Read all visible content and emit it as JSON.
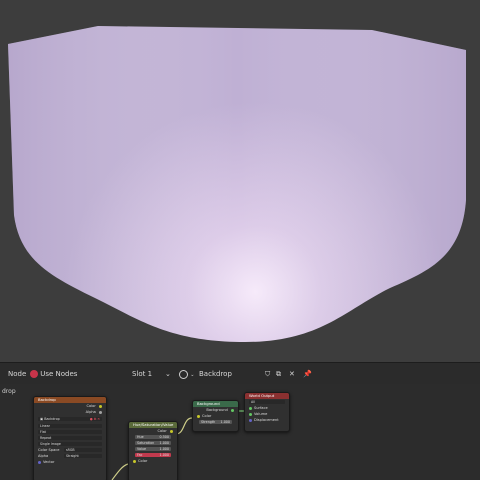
{
  "header": {
    "editor_type": "Node",
    "use_nodes_label": "Use Nodes",
    "slot_label": "Slot 1",
    "world_name": "Backdrop",
    "sidebar_fragment": "drop"
  },
  "colors": {
    "backdrop_shape": "#c7b8da",
    "viewport_bg": "#3d3d3d",
    "editor_bg": "#2c2c2c",
    "texture_header": "#8a4a24",
    "converter_header": "#5a6a3a",
    "shader_header": "#3a6a4a",
    "output_header": "#8a3030",
    "wire": "#cfcf8a"
  },
  "nodes": {
    "image_texture": {
      "title": "Backdrop",
      "out_color": "Color",
      "out_alpha": "Alpha",
      "image_name": "Backdrop",
      "linear_label": "Linear",
      "flat_label": "Flat",
      "repeat_label": "Repeat",
      "single_label": "Single Image",
      "colorspace_label": "Color Space",
      "colorspace_value": "sRGB",
      "alpha_label": "Alpha",
      "alpha_value": "Straight",
      "vector_label": "Vector"
    },
    "hsv": {
      "title": "Hue/Saturation/Value",
      "out_color": "Color",
      "hue_label": "Hue",
      "hue_value": "0.500",
      "sat_label": "Saturation",
      "sat_value": "1.000",
      "val_label": "Value",
      "val_value": "1.000",
      "fac_label": "Fac",
      "fac_value": "1.000",
      "color_label": "Color"
    },
    "background": {
      "title": "Background",
      "out_label": "Background",
      "in_color": "Color",
      "strength_label": "Strength",
      "strength_value": "1.000"
    },
    "world_output": {
      "title": "World Output",
      "target": "All",
      "surface_label": "Surface",
      "volume_label": "Volume",
      "displacement_label": "Displacement"
    }
  }
}
